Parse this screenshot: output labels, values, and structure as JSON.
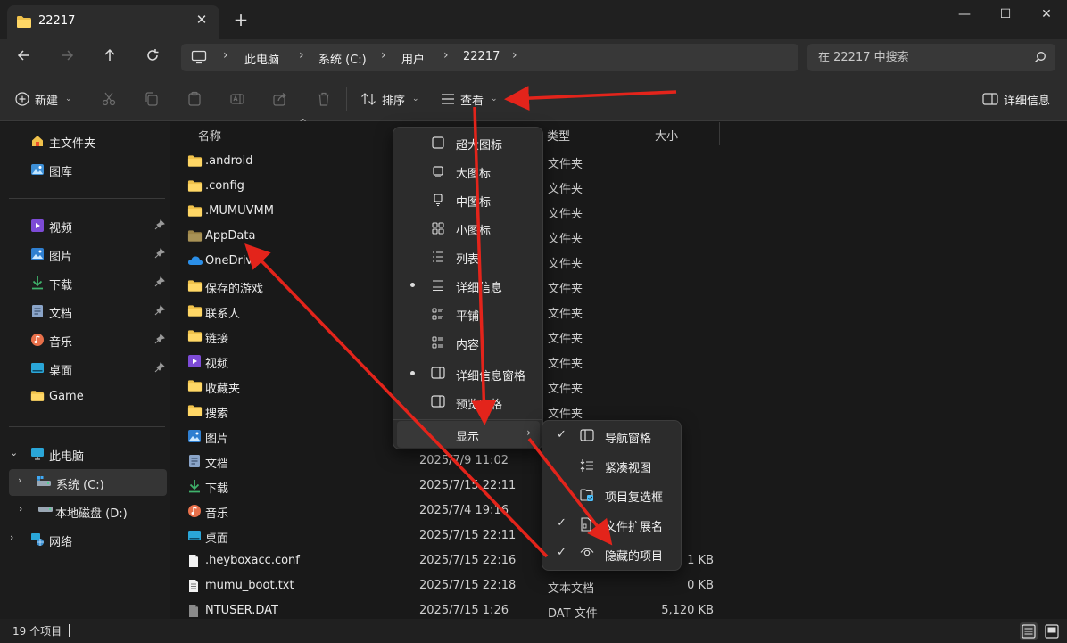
{
  "window": {
    "tab_title": "22217",
    "close_tab": "✕",
    "new_tab": "+",
    "minimize": "—",
    "maximize": "☐",
    "close": "✕"
  },
  "address": {
    "crumbs": [
      "此电脑",
      "系统 (C:)",
      "用户",
      "22217"
    ],
    "search_placeholder": "在 22217 中搜索"
  },
  "toolbar": {
    "new_label": "新建",
    "sort_label": "排序",
    "view_label": "查看",
    "more_label": "···",
    "details_label": "详细信息"
  },
  "sidebar": {
    "quick": [
      {
        "label": "主文件夹",
        "icon": "home-icon"
      },
      {
        "label": "图库",
        "icon": "gallery-icon"
      }
    ],
    "pinned": [
      {
        "label": "视频",
        "icon": "videos-icon"
      },
      {
        "label": "图片",
        "icon": "pictures-icon"
      },
      {
        "label": "下载",
        "icon": "downloads-icon"
      },
      {
        "label": "文档",
        "icon": "documents-icon"
      },
      {
        "label": "音乐",
        "icon": "music-icon"
      },
      {
        "label": "桌面",
        "icon": "desktop-icon"
      },
      {
        "label": "Game",
        "icon": "folder-icon"
      }
    ],
    "tree": [
      {
        "label": "此电脑",
        "icon": "this-pc-icon"
      },
      {
        "label": "系统 (C:)",
        "icon": "system-drive-icon"
      },
      {
        "label": "本地磁盘 (D:)",
        "icon": "drive-icon"
      },
      {
        "label": "网络",
        "icon": "network-icon"
      }
    ]
  },
  "columns": {
    "name": "名称",
    "type": "类型",
    "size": "大小"
  },
  "files": [
    {
      "name": ".android",
      "date": "",
      "type": "文件夹",
      "size": "",
      "icon": "folder"
    },
    {
      "name": ".config",
      "date": "",
      "type": "文件夹",
      "size": "",
      "icon": "folder"
    },
    {
      "name": ".MUMUVMM",
      "date": "",
      "type": "文件夹",
      "size": "",
      "icon": "folder"
    },
    {
      "name": "AppData",
      "date": "",
      "type": "文件夹",
      "size": "",
      "icon": "folder-hidden"
    },
    {
      "name": "OneDrive",
      "date": "",
      "type": "文件夹",
      "size": "",
      "icon": "onedrive"
    },
    {
      "name": "保存的游戏",
      "date": "",
      "type": "文件夹",
      "size": "",
      "icon": "folder"
    },
    {
      "name": "联系人",
      "date": "",
      "type": "文件夹",
      "size": "",
      "icon": "folder"
    },
    {
      "name": "链接",
      "date": "",
      "type": "文件夹",
      "size": "",
      "icon": "folder"
    },
    {
      "name": "视频",
      "date": "",
      "type": "文件夹",
      "size": "",
      "icon": "videos"
    },
    {
      "name": "收藏夹",
      "date": "",
      "type": "文件夹",
      "size": "",
      "icon": "folder"
    },
    {
      "name": "搜索",
      "date": "",
      "type": "文件夹",
      "size": "",
      "icon": "folder"
    },
    {
      "name": "图片",
      "date": "",
      "type": "",
      "size": "",
      "icon": "pictures"
    },
    {
      "name": "文档",
      "date": "2025/7/9 11:02",
      "type": "",
      "size": "",
      "icon": "documents"
    },
    {
      "name": "下载",
      "date": "2025/7/15 22:11",
      "type": "",
      "size": "",
      "icon": "downloads"
    },
    {
      "name": "音乐",
      "date": "2025/7/4 19:16",
      "type": "",
      "size": "",
      "icon": "music"
    },
    {
      "name": "桌面",
      "date": "2025/7/15 22:11",
      "type": "",
      "size": "",
      "icon": "desktop"
    },
    {
      "name": ".heyboxacc.conf",
      "date": "2025/7/15 22:16",
      "type": "",
      "size": "1 KB",
      "icon": "file"
    },
    {
      "name": "mumu_boot.txt",
      "date": "2025/7/15 22:18",
      "type": "文本文档",
      "size": "0 KB",
      "icon": "textfile"
    },
    {
      "name": "NTUSER.DAT",
      "date": "2025/7/15 1:26",
      "type": "DAT 文件",
      "size": "5,120 KB",
      "icon": "datfile"
    }
  ],
  "view_menu": {
    "items": [
      {
        "label": "超大图标",
        "icon": "extra-large-icons-icon",
        "selected": false
      },
      {
        "label": "大图标",
        "icon": "large-icons-icon",
        "selected": false
      },
      {
        "label": "中图标",
        "icon": "medium-icons-icon",
        "selected": false
      },
      {
        "label": "小图标",
        "icon": "small-icons-icon",
        "selected": false
      },
      {
        "label": "列表",
        "icon": "list-icon",
        "selected": false
      },
      {
        "label": "详细信息",
        "icon": "details-icon",
        "selected": true
      },
      {
        "label": "平铺",
        "icon": "tiles-icon",
        "selected": false
      },
      {
        "label": "内容",
        "icon": "content-icon",
        "selected": false
      }
    ],
    "panes": [
      {
        "label": "详细信息窗格",
        "icon": "details-pane-icon",
        "selected": true
      },
      {
        "label": "预览窗格",
        "icon": "preview-pane-icon",
        "selected": false
      }
    ],
    "show_label": "显示"
  },
  "show_submenu": {
    "items": [
      {
        "label": "导航窗格",
        "icon": "navigation-pane-icon",
        "checked": true
      },
      {
        "label": "紧凑视图",
        "icon": "compact-view-icon",
        "checked": false
      },
      {
        "label": "项目复选框",
        "icon": "item-checkbox-icon",
        "checked": false
      },
      {
        "label": "文件扩展名",
        "icon": "file-extension-icon",
        "checked": true
      },
      {
        "label": "隐藏的项目",
        "icon": "hidden-items-icon",
        "checked": true
      }
    ]
  },
  "status": {
    "count": "19 个项目"
  },
  "colors": {
    "folder": "#f0c24b",
    "accent": "#4cc2ff",
    "annotation": "#e3241b"
  }
}
